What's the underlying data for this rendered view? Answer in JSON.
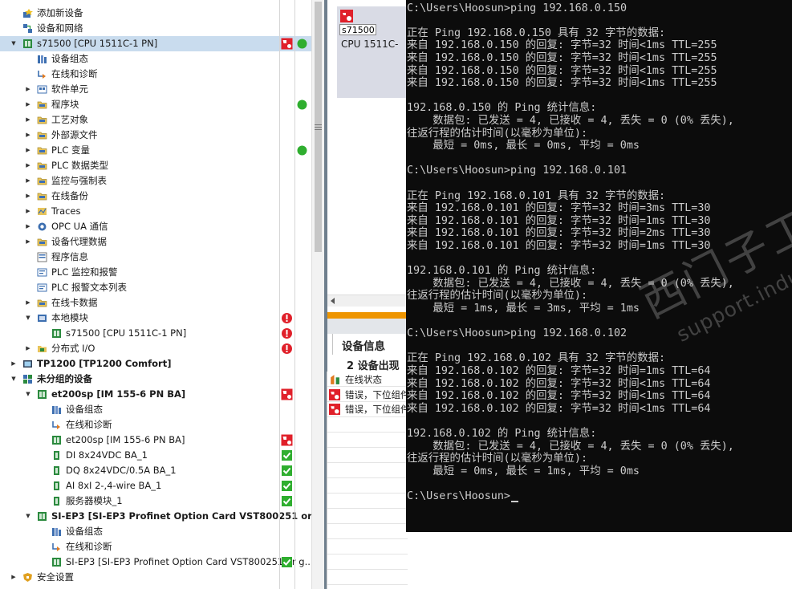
{
  "project_tree": {
    "rows": [
      {
        "label": "添加新设备",
        "level": 0,
        "expand": "none",
        "icon": "add-device-icon",
        "bold": false,
        "selected": false,
        "status1": "",
        "status2": ""
      },
      {
        "label": "设备和网络",
        "level": 0,
        "expand": "none",
        "icon": "devices-networks-icon",
        "bold": false,
        "selected": false,
        "status1": "",
        "status2": ""
      },
      {
        "label": "s71500 [CPU 1511C-1 PN]",
        "level": 0,
        "expand": "expanded",
        "icon": "plc-icon",
        "bold": false,
        "selected": true,
        "status1": "error-diag",
        "status2": "ok-dot"
      },
      {
        "label": "设备组态",
        "level": 1,
        "expand": "none",
        "icon": "device-config-icon",
        "bold": false,
        "selected": false,
        "status1": "",
        "status2": ""
      },
      {
        "label": "在线和诊断",
        "level": 1,
        "expand": "none",
        "icon": "online-diag-icon",
        "bold": false,
        "selected": false,
        "status1": "",
        "status2": ""
      },
      {
        "label": "软件单元",
        "level": 1,
        "expand": "collapsed",
        "icon": "software-units-icon",
        "bold": false,
        "selected": false,
        "status1": "",
        "status2": ""
      },
      {
        "label": "程序块",
        "level": 1,
        "expand": "collapsed",
        "icon": "folder-icon",
        "bold": false,
        "selected": false,
        "status1": "",
        "status2": "ok-dot"
      },
      {
        "label": "工艺对象",
        "level": 1,
        "expand": "collapsed",
        "icon": "folder-icon",
        "bold": false,
        "selected": false,
        "status1": "",
        "status2": ""
      },
      {
        "label": "外部源文件",
        "level": 1,
        "expand": "collapsed",
        "icon": "folder-icon",
        "bold": false,
        "selected": false,
        "status1": "",
        "status2": ""
      },
      {
        "label": "PLC 变量",
        "level": 1,
        "expand": "collapsed",
        "icon": "folder-icon",
        "bold": false,
        "selected": false,
        "status1": "",
        "status2": "ok-dot"
      },
      {
        "label": "PLC 数据类型",
        "level": 1,
        "expand": "collapsed",
        "icon": "folder-icon",
        "bold": false,
        "selected": false,
        "status1": "",
        "status2": ""
      },
      {
        "label": "监控与强制表",
        "level": 1,
        "expand": "collapsed",
        "icon": "folder-icon",
        "bold": false,
        "selected": false,
        "status1": "",
        "status2": ""
      },
      {
        "label": "在线备份",
        "level": 1,
        "expand": "collapsed",
        "icon": "folder-icon",
        "bold": false,
        "selected": false,
        "status1": "",
        "status2": ""
      },
      {
        "label": "Traces",
        "level": 1,
        "expand": "collapsed",
        "icon": "traces-icon",
        "bold": false,
        "selected": false,
        "status1": "",
        "status2": ""
      },
      {
        "label": "OPC UA 通信",
        "level": 1,
        "expand": "collapsed",
        "icon": "opcua-icon",
        "bold": false,
        "selected": false,
        "status1": "",
        "status2": ""
      },
      {
        "label": "设备代理数据",
        "level": 1,
        "expand": "collapsed",
        "icon": "folder-icon",
        "bold": false,
        "selected": false,
        "status1": "",
        "status2": ""
      },
      {
        "label": "程序信息",
        "level": 1,
        "expand": "none",
        "icon": "program-info-icon",
        "bold": false,
        "selected": false,
        "status1": "",
        "status2": ""
      },
      {
        "label": "PLC 监控和报警",
        "level": 1,
        "expand": "none",
        "icon": "plc-alarm-icon",
        "bold": false,
        "selected": false,
        "status1": "",
        "status2": ""
      },
      {
        "label": "PLC 报警文本列表",
        "level": 1,
        "expand": "none",
        "icon": "alarm-text-icon",
        "bold": false,
        "selected": false,
        "status1": "",
        "status2": ""
      },
      {
        "label": "在线卡数据",
        "level": 1,
        "expand": "collapsed",
        "icon": "folder-icon",
        "bold": false,
        "selected": false,
        "status1": "",
        "status2": ""
      },
      {
        "label": "本地模块",
        "level": 1,
        "expand": "expanded",
        "icon": "local-modules-icon",
        "bold": false,
        "selected": false,
        "status1": "error-mark",
        "status2": ""
      },
      {
        "label": "s71500 [CPU 1511C-1 PN]",
        "level": 2,
        "expand": "none",
        "icon": "cpu-module-icon",
        "bold": false,
        "selected": false,
        "status1": "error-mark",
        "status2": ""
      },
      {
        "label": "分布式 I/O",
        "level": 1,
        "expand": "collapsed",
        "icon": "distributed-io-icon",
        "bold": false,
        "selected": false,
        "status1": "error-mark",
        "status2": ""
      },
      {
        "label": "TP1200 [TP1200 Comfort]",
        "level": 0,
        "expand": "collapsed",
        "icon": "hmi-icon",
        "bold": true,
        "selected": false,
        "status1": "",
        "status2": ""
      },
      {
        "label": "未分组的设备",
        "level": 0,
        "expand": "expanded",
        "icon": "ungrouped-devices-icon",
        "bold": true,
        "selected": false,
        "status1": "",
        "status2": ""
      },
      {
        "label": "et200sp [IM 155-6 PN BA]",
        "level": 1,
        "expand": "expanded",
        "icon": "et200sp-icon",
        "bold": true,
        "selected": false,
        "status1": "error-diag",
        "status2": ""
      },
      {
        "label": "设备组态",
        "level": 2,
        "expand": "none",
        "icon": "device-config-icon",
        "bold": false,
        "selected": false,
        "status1": "",
        "status2": ""
      },
      {
        "label": "在线和诊断",
        "level": 2,
        "expand": "none",
        "icon": "online-diag-icon",
        "bold": false,
        "selected": false,
        "status1": "",
        "status2": ""
      },
      {
        "label": "et200sp [IM 155-6 PN BA]",
        "level": 2,
        "expand": "none",
        "icon": "im-module-icon",
        "bold": false,
        "selected": false,
        "status1": "error-diag",
        "status2": ""
      },
      {
        "label": "DI 8x24VDC BA_1",
        "level": 2,
        "expand": "none",
        "icon": "io-module-icon",
        "bold": false,
        "selected": false,
        "status1": "ok-check",
        "status2": ""
      },
      {
        "label": "DQ 8x24VDC/0.5A BA_1",
        "level": 2,
        "expand": "none",
        "icon": "io-module-icon",
        "bold": false,
        "selected": false,
        "status1": "ok-check",
        "status2": ""
      },
      {
        "label": "AI 8xI 2-,4-wire BA_1",
        "level": 2,
        "expand": "none",
        "icon": "io-module-icon",
        "bold": false,
        "selected": false,
        "status1": "ok-check",
        "status2": ""
      },
      {
        "label": "服务器模块_1",
        "level": 2,
        "expand": "none",
        "icon": "io-module-icon",
        "bold": false,
        "selected": false,
        "status1": "ok-check",
        "status2": ""
      },
      {
        "label": "SI-EP3 [SI-EP3 Profinet Option Card VST800251 or ...",
        "level": 1,
        "expand": "expanded",
        "icon": "si-ep3-icon",
        "bold": true,
        "selected": false,
        "status1": "",
        "status2": ""
      },
      {
        "label": "设备组态",
        "level": 2,
        "expand": "none",
        "icon": "device-config-icon",
        "bold": false,
        "selected": false,
        "status1": "",
        "status2": ""
      },
      {
        "label": "在线和诊断",
        "level": 2,
        "expand": "none",
        "icon": "online-diag-icon",
        "bold": false,
        "selected": false,
        "status1": "",
        "status2": ""
      },
      {
        "label": "SI-EP3 [SI-EP3 Profinet Option Card VST800251 or g...",
        "level": 2,
        "expand": "none",
        "icon": "im-module-icon",
        "bold": false,
        "selected": false,
        "status1": "ok-check",
        "status2": ""
      },
      {
        "label": "安全设置",
        "level": 0,
        "expand": "collapsed",
        "icon": "security-settings-icon",
        "bold": false,
        "selected": false,
        "status1": "",
        "status2": ""
      }
    ]
  },
  "device_view": {
    "device_name": "s71500",
    "device_type": "CPU 1511C-"
  },
  "inspector": {
    "tab_label": "设备信息",
    "summary": "2 设备出现",
    "rows": [
      {
        "label": "在线状态",
        "icon": "online-status-icon"
      },
      {
        "label": "错误，下位组件",
        "icon": "error-diag-icon"
      },
      {
        "label": "错误，下位组件",
        "icon": "error-diag-icon"
      }
    ]
  },
  "terminal": {
    "lines": [
      "C:\\Users\\Hoosun>ping 192.168.0.150",
      "",
      "正在 Ping 192.168.0.150 具有 32 字节的数据:",
      "来自 192.168.0.150 的回复: 字节=32 时间<1ms TTL=255",
      "来自 192.168.0.150 的回复: 字节=32 时间<1ms TTL=255",
      "来自 192.168.0.150 的回复: 字节=32 时间<1ms TTL=255",
      "来自 192.168.0.150 的回复: 字节=32 时间<1ms TTL=255",
      "",
      "192.168.0.150 的 Ping 统计信息:",
      "    数据包: 已发送 = 4, 已接收 = 4, 丢失 = 0 (0% 丢失),",
      "往返行程的估计时间(以毫秒为单位):",
      "    最短 = 0ms, 最长 = 0ms, 平均 = 0ms",
      "",
      "C:\\Users\\Hoosun>ping 192.168.0.101",
      "",
      "正在 Ping 192.168.0.101 具有 32 字节的数据:",
      "来自 192.168.0.101 的回复: 字节=32 时间=3ms TTL=30",
      "来自 192.168.0.101 的回复: 字节=32 时间=1ms TTL=30",
      "来自 192.168.0.101 的回复: 字节=32 时间=2ms TTL=30",
      "来自 192.168.0.101 的回复: 字节=32 时间=1ms TTL=30",
      "",
      "192.168.0.101 的 Ping 统计信息:",
      "    数据包: 已发送 = 4, 已接收 = 4, 丢失 = 0 (0% 丢失),",
      "往返行程的估计时间(以毫秒为单位):",
      "    最短 = 1ms, 最长 = 3ms, 平均 = 1ms",
      "",
      "C:\\Users\\Hoosun>ping 192.168.0.102",
      "",
      "正在 Ping 192.168.0.102 具有 32 字节的数据:",
      "来自 192.168.0.102 的回复: 字节=32 时间=1ms TTL=64",
      "来自 192.168.0.102 的回复: 字节=32 时间<1ms TTL=64",
      "来自 192.168.0.102 的回复: 字节=32 时间<1ms TTL=64",
      "来自 192.168.0.102 的回复: 字节=32 时间<1ms TTL=64",
      "",
      "192.168.0.102 的 Ping 统计信息:",
      "    数据包: 已发送 = 4, 已接收 = 4, 丢失 = 0 (0% 丢失),",
      "往返行程的估计时间(以毫秒为单位):",
      "    最短 = 0ms, 最长 = 1ms, 平均 = 0ms",
      "",
      "C:\\Users\\Hoosun>"
    ]
  },
  "watermark": {
    "line1": "西门子工业",
    "line2": "support.industry.siemens.com/cs"
  },
  "colors": {
    "selection": "#c9dcee",
    "ok_green": "#2fae2f",
    "error_red": "#e0202a",
    "orange_accent": "#ee9500",
    "terminal_bg": "#0c0c0c",
    "terminal_text": "#cccccc"
  }
}
